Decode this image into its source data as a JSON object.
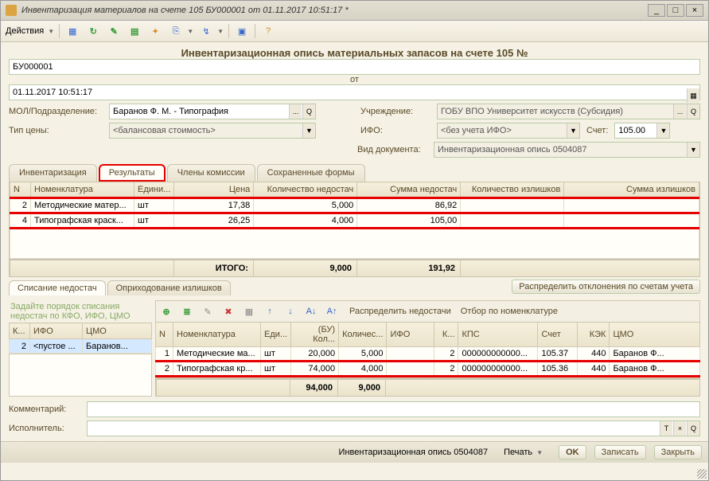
{
  "window": {
    "title": "Инвентаризация материалов на счете 105 БУ000001 от 01.11.2017 10:51:17 *"
  },
  "menu": {
    "actions": "Действия"
  },
  "docheader": {
    "title": "Инвентаризационная опись материальных запасов на счете 105 №",
    "num": "БУ000001",
    "from": "от",
    "date": "01.11.2017 10:51:17"
  },
  "fields": {
    "mol_label": "МОЛ/Подразделение:",
    "mol_value": "Баранов Ф. М. - Типография",
    "org_label": "Учреждение:",
    "org_value": "ГОБУ ВПО Университет искусств (Субсидия)",
    "price_label": "Тип цены:",
    "price_value": "<балансовая стоимость>",
    "ifo_label": "ИФО:",
    "ifo_value": "<без учета ИФО>",
    "acct_label": "Счет:",
    "acct_value": "105.00",
    "doctype_label": "Вид документа:",
    "doctype_value": "Инвентаризационная опись 0504087"
  },
  "tabs": {
    "t1": "Инвентаризация",
    "t2": "Результаты",
    "t3": "Члены комиссии",
    "t4": "Сохраненные формы"
  },
  "grid_top": {
    "cols": {
      "n": "N",
      "nom": "Номенклатура",
      "unit": "Едини...",
      "price": "Цена",
      "qty_short": "Количество недостач",
      "sum_short": "Сумма недостач",
      "qty_over": "Количество излишков",
      "sum_over": "Сумма излишков"
    },
    "rows": [
      {
        "n": "2",
        "nom": "Методические матер...",
        "unit": "шт",
        "price": "17,38",
        "qty_short": "5,000",
        "sum_short": "86,92",
        "qty_over": "",
        "sum_over": ""
      },
      {
        "n": "4",
        "nom": "Типографская краск...",
        "unit": "шт",
        "price": "26,25",
        "qty_short": "4,000",
        "sum_short": "105,00",
        "qty_over": "",
        "sum_over": ""
      }
    ],
    "totals": {
      "label": "ИТОГО:",
      "qty_short": "9,000",
      "sum_short": "191,92"
    }
  },
  "subtabs": {
    "s1": "Списание недостач",
    "s2": "Оприходование излишков"
  },
  "distribute_btn": "Распределить отклонения по счетам учета",
  "left": {
    "hint": "Задайте порядок списания недостач по КФО, ИФО, ЦМО",
    "cols": {
      "k": "К...",
      "ifo": "ИФО",
      "cmo": "ЦМО"
    },
    "rows": [
      {
        "k": "2",
        "ifo": "<пустое ...",
        "cmo": "Баранов..."
      }
    ]
  },
  "subtoolbar": {
    "spread": "Распределить недостачи",
    "filter": "Отбор по номенклатуре"
  },
  "grid_bottom": {
    "cols": {
      "n": "N",
      "nom": "Номенклатура",
      "unit": "Еди...",
      "bu": "(БУ) Кол...",
      "qty": "Количес...",
      "ifo": "ИФО",
      "k": "К...",
      "kps": "КПС",
      "acct": "Счет",
      "kek": "КЭК",
      "cmo": "ЦМО"
    },
    "rows": [
      {
        "n": "1",
        "nom": "Методические ма...",
        "unit": "шт",
        "bu": "20,000",
        "qty": "5,000",
        "ifo": "",
        "k": "2",
        "kps": "000000000000...",
        "acct": "105.37",
        "kek": "440",
        "cmo": "Баранов Ф..."
      },
      {
        "n": "2",
        "nom": "Типографская кр...",
        "unit": "шт",
        "bu": "74,000",
        "qty": "4,000",
        "ifo": "",
        "k": "2",
        "kps": "000000000000...",
        "acct": "105.36",
        "kek": "440",
        "cmo": "Баранов Ф..."
      }
    ],
    "totals": {
      "bu": "94,000",
      "qty": "9,000"
    }
  },
  "footer": {
    "comment_label": "Комментарий:",
    "executor_label": "Исполнитель:"
  },
  "status": {
    "doc": "Инвентаризационная опись 0504087",
    "print": "Печать",
    "ok": "OK",
    "save": "Записать",
    "close": "Закрыть"
  }
}
